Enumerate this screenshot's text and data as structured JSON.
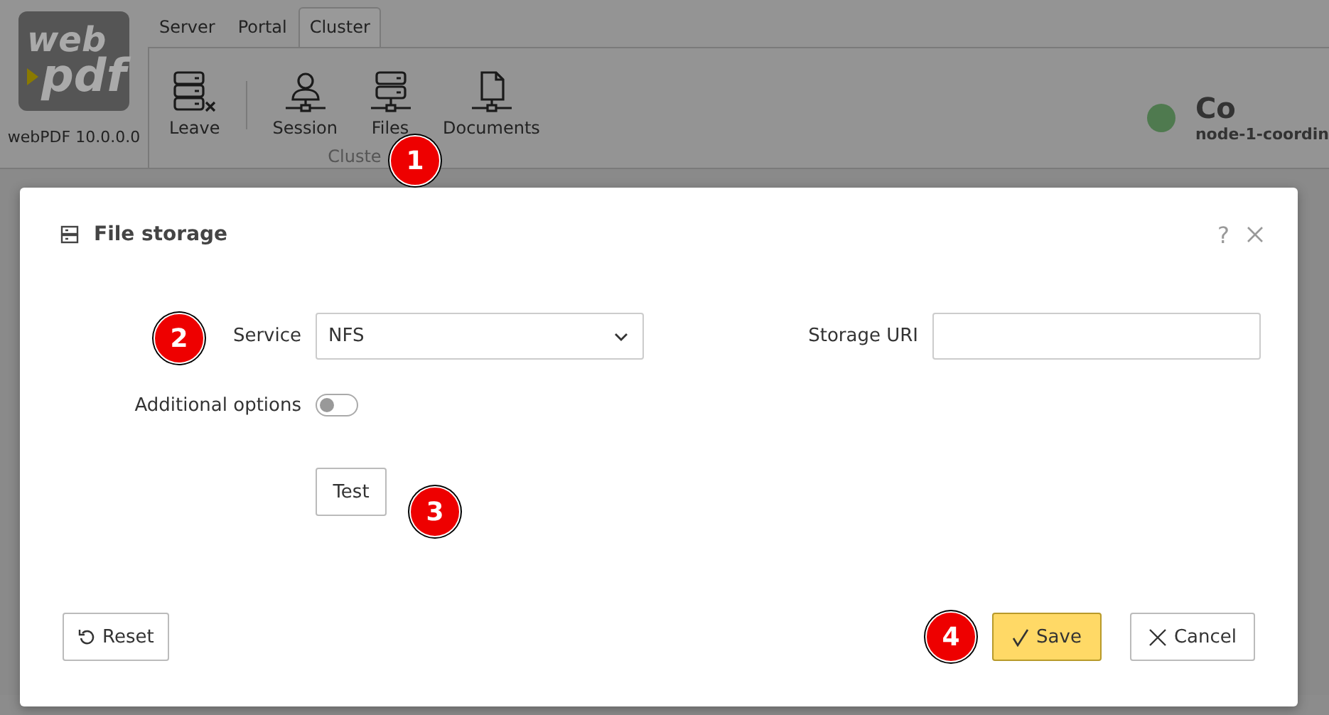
{
  "app": {
    "logo": {
      "line_1": "web",
      "line_2": "pdf"
    },
    "version": "webPDF 10.0.0.0",
    "tabs": [
      {
        "label": "Server",
        "selected": false
      },
      {
        "label": "Portal",
        "selected": false
      },
      {
        "label": "Cluster",
        "selected": true
      }
    ],
    "ribbon": {
      "buttons": [
        {
          "label": "Leave",
          "kind": "leave"
        },
        {
          "label": "Session",
          "kind": "session"
        },
        {
          "label": "Files",
          "kind": "files"
        },
        {
          "label": "Documents",
          "kind": "documents"
        }
      ],
      "group_label": "Cluste"
    },
    "node": {
      "color": "#4f7a4f",
      "title": "Co",
      "name": "node-1-coordin"
    }
  },
  "dialog": {
    "title": "File storage",
    "help": "?",
    "service": {
      "label": "Service",
      "value": "NFS"
    },
    "storage_uri": {
      "label": "Storage URI"
    },
    "additional_options": {
      "label": "Additional options",
      "on": false
    },
    "test_button": "Test",
    "reset_button": "Reset",
    "save_button": "Save",
    "cancel_button": "Cancel"
  },
  "callouts": [
    "1",
    "2",
    "3",
    "4"
  ]
}
